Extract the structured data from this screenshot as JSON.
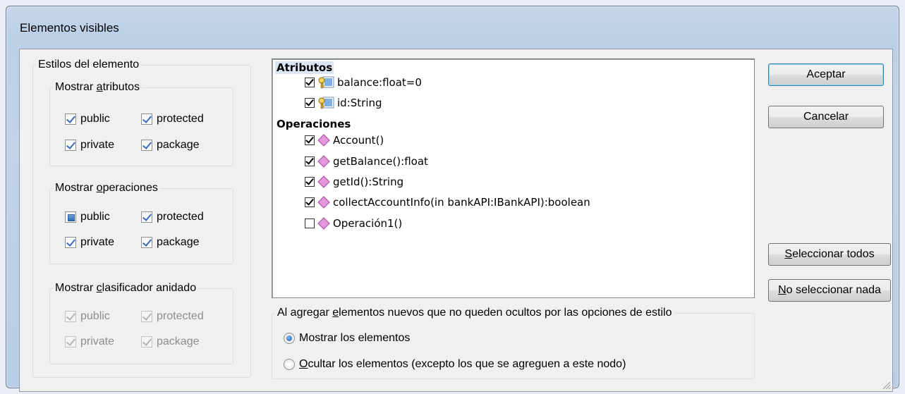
{
  "window": {
    "title": "Elementos visibles"
  },
  "styles": {
    "legend": "Estilos del elemento",
    "attributes": {
      "legend_pre": "Mostrar ",
      "legend_u": "a",
      "legend_post": "tributos",
      "public": "public",
      "protected": "protected",
      "private": "private",
      "package": "package"
    },
    "operations": {
      "legend_pre": "Mostrar ",
      "legend_u": "o",
      "legend_post": "peraciones",
      "public": "public",
      "protected": "protected",
      "private": "private",
      "package": "package"
    },
    "nested": {
      "legend_pre": "Mostrar ",
      "legend_u": "c",
      "legend_post": "lasificador anidado",
      "public": "public",
      "protected": "protected",
      "private": "private",
      "package": "package"
    }
  },
  "tree": {
    "attributes_header": "Atributos",
    "attributes": [
      {
        "label": "balance:float=0",
        "checked": true
      },
      {
        "label": "id:String",
        "checked": true
      }
    ],
    "operations_header": "Operaciones",
    "operations": [
      {
        "label": "Account()",
        "checked": true
      },
      {
        "label": "getBalance():float",
        "checked": true
      },
      {
        "label": "getId():String",
        "checked": true
      },
      {
        "label": "collectAccountInfo(in bankAPI:IBankAPI):boolean",
        "checked": true
      },
      {
        "label": "Operación1()",
        "checked": false
      }
    ]
  },
  "buttons": {
    "accept": "Aceptar",
    "cancel": "Cancelar",
    "select_all_u": "S",
    "select_all_rest": "eleccionar todos",
    "select_none_u": "N",
    "select_none_rest": "o seleccionar nada"
  },
  "new_elements": {
    "legend_pre": "Al agregar ",
    "legend_u": "e",
    "legend_post": "lementos nuevos que no queden ocultos por las opciones de estilo",
    "show": "Mostrar los elementos",
    "hide_u": "O",
    "hide_rest": "cultar los elementos (excepto los que se agreguen a este nodo)"
  },
  "colors": {
    "title_bar": "#bcd0e8",
    "selection": "#dbe6f5",
    "operation_icon": "#d96fd0",
    "attribute_icon": "#c89a1e"
  }
}
